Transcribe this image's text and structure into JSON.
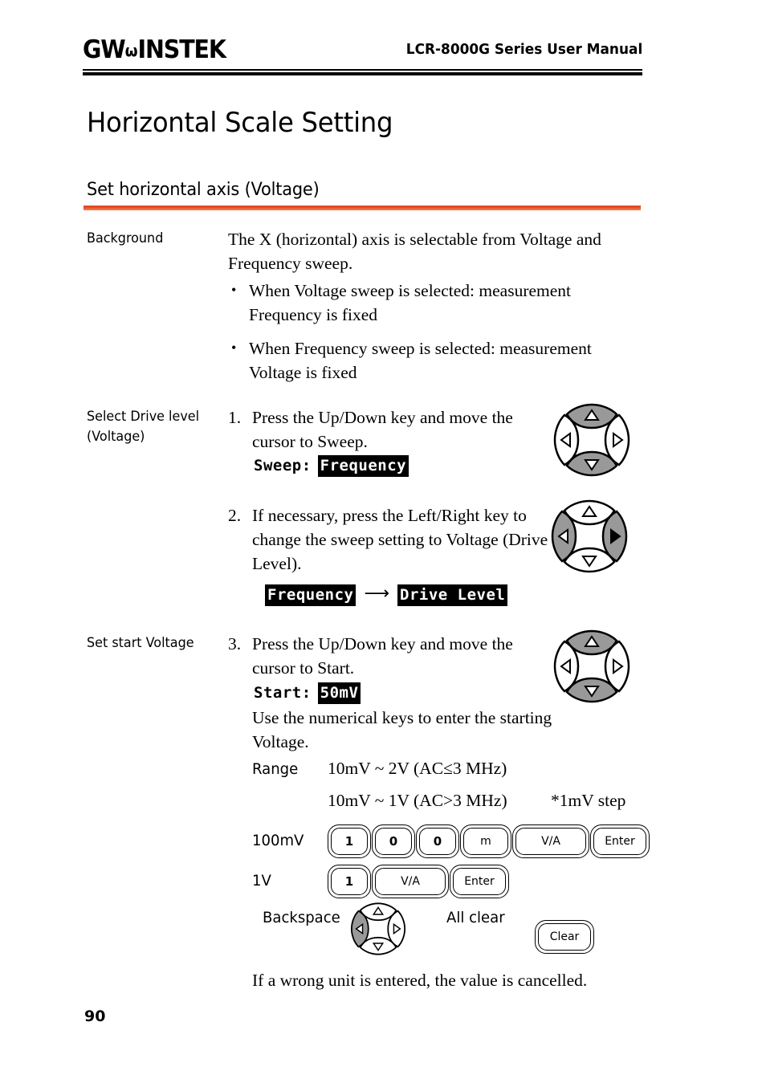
{
  "header": {
    "logo_gw": "GW",
    "logo_omega": "ω",
    "logo_instek": "INSTEK",
    "manual_title": "LCR-8000G Series User Manual"
  },
  "headings": {
    "h1": "Horizontal Scale Setting",
    "h2": "Set horizontal axis (Voltage)"
  },
  "background": {
    "label": "Background",
    "paragraph": "The X (horizontal) axis is selectable from Voltage and Frequency sweep.",
    "bullets": [
      "When Voltage sweep is selected: measurement Frequency is fixed",
      "When Frequency sweep is selected: measurement Voltage is fixed"
    ]
  },
  "step1": {
    "side_label": "Select Drive level (Voltage)",
    "number": "1.",
    "text": "Press the Up/Down key and move the cursor to Sweep.",
    "display_prefix": "Sweep:",
    "display_value": "Frequency",
    "dpad_highlight": "up-down"
  },
  "step2": {
    "number": "2.",
    "text": "If necessary, press the Left/Right key to change the sweep setting to Voltage (Drive Level).",
    "from_value": "Frequency",
    "arrow": "⟶",
    "to_value": "Drive Level",
    "dpad_highlight": "left-right"
  },
  "step3": {
    "side_label": "Set start Voltage",
    "number": "3.",
    "text": "Press the Up/Down key and move the cursor to Start.",
    "display_prefix": "Start:",
    "display_value": "50mV",
    "text2": "Use the numerical keys to enter the starting Voltage.",
    "dpad_highlight": "up-down"
  },
  "range": {
    "label": "Range",
    "line1": "10mV ~ 2V (AC≤3 MHz)",
    "line2": "10mV ~ 1V (AC>3 MHz)",
    "note": "*1mV step"
  },
  "key_sequences": [
    {
      "label": "100mV",
      "keys": [
        "1",
        "0",
        "0",
        "m",
        "V/A",
        "Enter"
      ]
    },
    {
      "label": "1V",
      "keys": [
        "1",
        "V/A",
        "Enter"
      ]
    }
  ],
  "edit_keys": {
    "backspace_label": "Backspace",
    "allclear_label": "All clear",
    "clear_button": "Clear",
    "backspace_highlight": "left"
  },
  "footer_note": "If a wrong unit is entered, the value is cancelled.",
  "page_number": "90",
  "colors": {
    "accent_rule": "#e5512a",
    "key_highlight": "#999999",
    "text": "#000000"
  }
}
